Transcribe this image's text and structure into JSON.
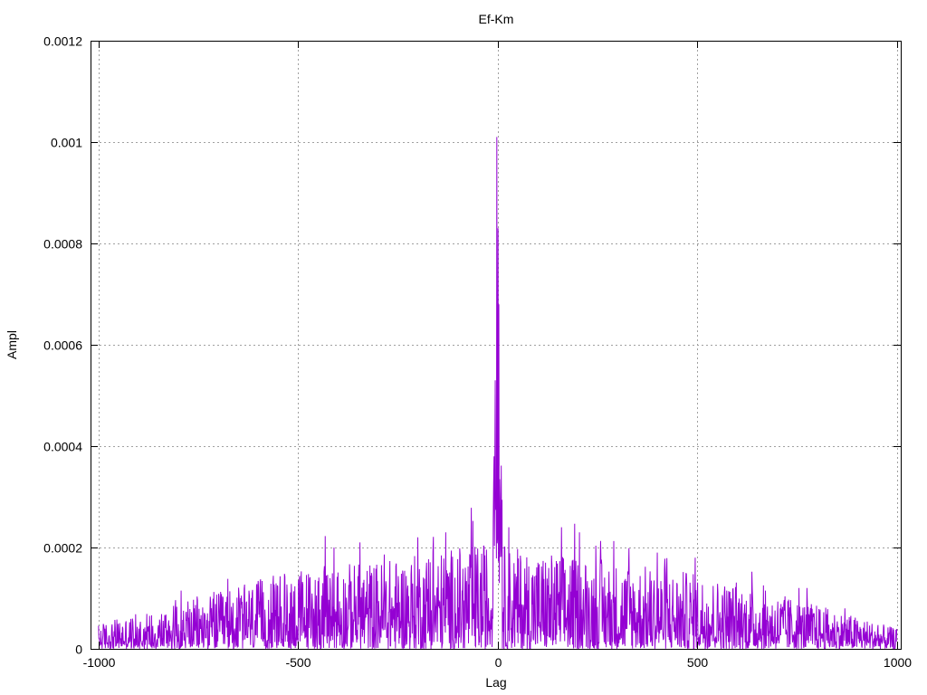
{
  "chart_data": {
    "type": "line",
    "title": "Ef-Km",
    "xlabel": "Lag",
    "ylabel": "Ampl",
    "xlim": [
      -1020,
      1010
    ],
    "ylim": [
      0,
      0.0012
    ],
    "x_ticks": [
      -1000,
      -500,
      0,
      500,
      1000
    ],
    "x_tick_labels": [
      "-1000",
      "-500",
      "0",
      "500",
      "1000"
    ],
    "y_ticks": [
      0,
      0.0002,
      0.0004,
      0.0006,
      0.0008,
      0.001,
      0.0012
    ],
    "y_tick_labels": [
      "0",
      "0.0002",
      "0.0004",
      "0.0006",
      "0.0008",
      "0.001",
      "0.0012"
    ],
    "grid": true,
    "series": [
      {
        "color": "#9400d3",
        "peaks": [
          {
            "x": -2,
            "y": 0.00101
          },
          {
            "x": 1,
            "y": 0.00083
          },
          {
            "x": 3,
            "y": 0.00068
          },
          {
            "x": -6,
            "y": 0.00053
          },
          {
            "x": -9,
            "y": 0.00038
          },
          {
            "x": 28,
            "y": 0.00024
          },
          {
            "x": 160,
            "y": 0.00024
          },
          {
            "x": 205,
            "y": 0.00023
          },
          {
            "x": -410,
            "y": 0.0002
          },
          {
            "x": -345,
            "y": 0.00021
          },
          {
            "x": -200,
            "y": 0.00022
          },
          {
            "x": -130,
            "y": 0.00023
          },
          {
            "x": 400,
            "y": 0.00019
          },
          {
            "x": 495,
            "y": 0.00018
          },
          {
            "x": 870,
            "y": 8e-05
          }
        ],
        "envelope": [
          {
            "x": -1000,
            "y": 5e-05
          },
          {
            "x": -750,
            "y": 0.0001
          },
          {
            "x": -500,
            "y": 0.00016
          },
          {
            "x": -250,
            "y": 0.00018
          },
          {
            "x": -50,
            "y": 0.00021
          },
          {
            "x": 0,
            "y": 0.00021
          },
          {
            "x": 50,
            "y": 0.0002
          },
          {
            "x": 250,
            "y": 0.00018
          },
          {
            "x": 500,
            "y": 0.00015
          },
          {
            "x": 750,
            "y": 0.0001
          },
          {
            "x": 1000,
            "y": 4e-05
          }
        ]
      }
    ]
  }
}
